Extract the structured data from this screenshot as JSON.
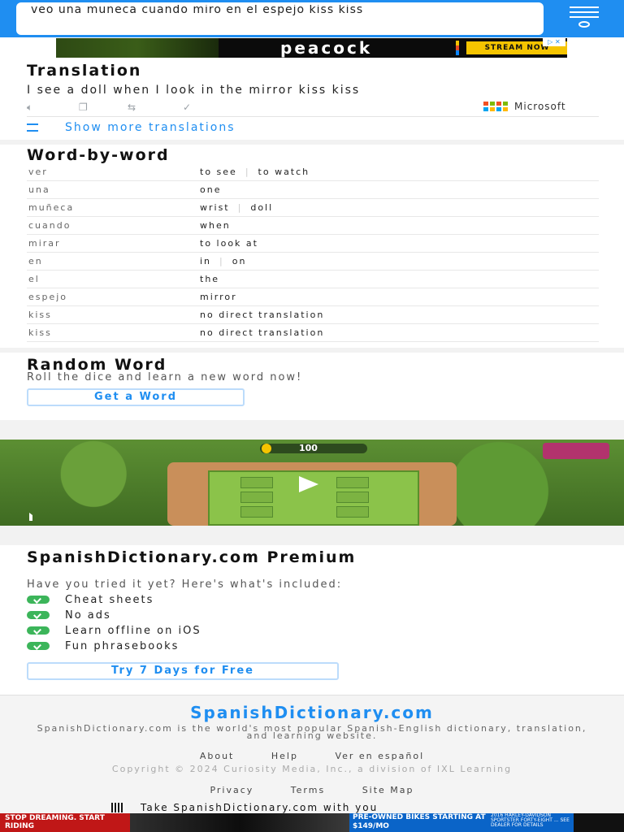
{
  "header": {
    "query_value": "veo una muneca cuando miro en el espejo kiss kiss"
  },
  "ad_top": {
    "brand": "peacock",
    "cta": "STREAM NOW",
    "ad_badge": "▷ ✕"
  },
  "translation": {
    "title": "Translation",
    "text": "I see a doll when I look in the mirror kiss kiss",
    "provider": "Microsoft",
    "show_more": "Show more translations",
    "icons": [
      "speaker-icon",
      "copy-icon",
      "swap-icon",
      "check-icon"
    ]
  },
  "word_by_word": {
    "title": "Word-by-word",
    "rows": [
      {
        "es": "ver",
        "en": [
          "to see",
          "to watch"
        ]
      },
      {
        "es": "una",
        "en": [
          "one"
        ]
      },
      {
        "es": "muñeca",
        "en": [
          "wrist",
          "doll"
        ]
      },
      {
        "es": "cuando",
        "en": [
          "when"
        ]
      },
      {
        "es": "mirar",
        "en": [
          "to look at"
        ]
      },
      {
        "es": "en",
        "en": [
          "in",
          "on"
        ]
      },
      {
        "es": "el",
        "en": [
          "the"
        ]
      },
      {
        "es": "espejo",
        "en": [
          "mirror"
        ]
      },
      {
        "es": "kiss",
        "en": [
          "no direct translation"
        ]
      },
      {
        "es": "kiss",
        "en": [
          "no direct translation"
        ]
      }
    ]
  },
  "random_word": {
    "title": "Random Word",
    "subtitle": "Roll the dice and learn a new word now!",
    "button": "Get a Word"
  },
  "game_ad": {
    "score": "100"
  },
  "premium": {
    "title": "SpanishDictionary.com Premium",
    "subtitle": "Have you tried it yet? Here's what's included:",
    "features": [
      "Cheat sheets",
      "No ads",
      "Learn offline on iOS",
      "Fun phrasebooks"
    ],
    "button": "Try 7 Days for Free"
  },
  "footer": {
    "logo": "SpanishDictionary.com",
    "description": "SpanishDictionary.com is the world's most popular Spanish-English dictionary, translation, and learning website.",
    "links_row1": [
      "About",
      "Help",
      "Ver en español"
    ],
    "copyright": "Copyright © 2024 Curiosity Media, Inc., a division of IXL Learning",
    "links_row2": [
      "Privacy",
      "Terms",
      "Site Map"
    ],
    "app_cta": "Take SpanishDictionary.com with you"
  },
  "ad_bottom": {
    "left": "STOP DREAMING. START RIDING",
    "middle": "PRE-OWNED BIKES STARTING AT $149/MO",
    "fine_print": "2016 HARLEY-DAVIDSON SPORTSTER FORTY-EIGHT ... SEE DEALER FOR DETAILS"
  },
  "colors": {
    "brand_blue": "#1f8ef1",
    "check_green": "#3cb55a",
    "outline_blue": "#bcdcfb"
  }
}
